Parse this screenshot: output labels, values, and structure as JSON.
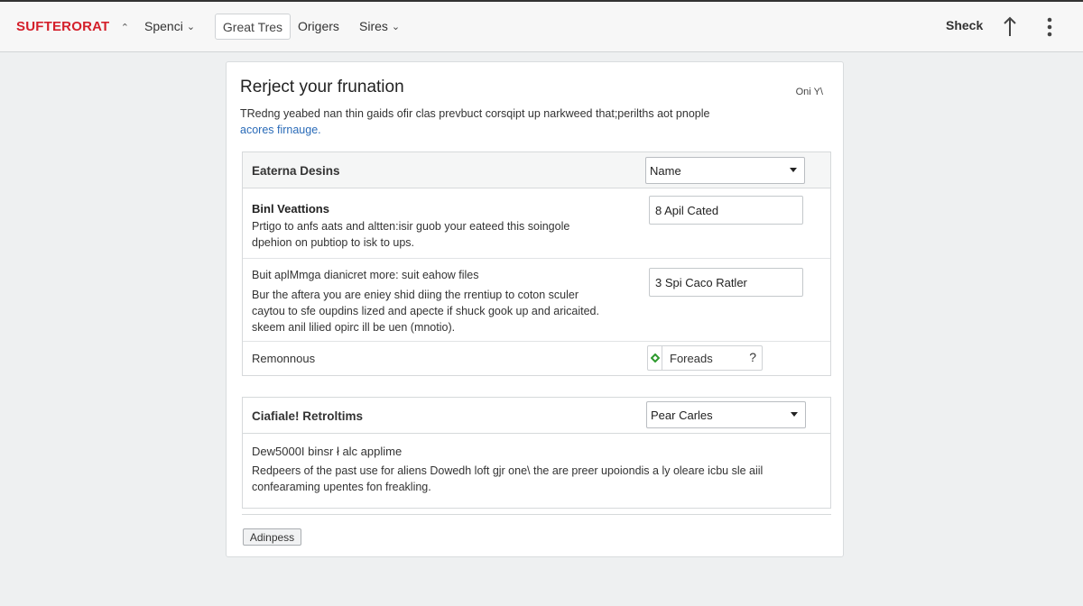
{
  "topbar": {
    "brand": "SUFTERORAT",
    "brand_caret": "⌃",
    "nav": [
      {
        "label": "Spenci",
        "caret": "⌄"
      },
      {
        "label": "Great Tres"
      },
      {
        "label": "Origers"
      },
      {
        "label": "Sires",
        "caret": "⌄"
      }
    ],
    "right_label": "Sheck",
    "icons": [
      "upload-arrow-icon",
      "kebab-menu-icon"
    ],
    "brand_color": "#d4202b"
  },
  "card": {
    "title": "Rerject your frunation",
    "corner": "Oni Y\\",
    "desc": "TRedng yeabed nan thin gaids ofir clas prevbuct corsqipt up narkweed that;perilths aot pnople",
    "desc_link": "acores firnauge.",
    "section1": {
      "header_title": "Eaterna Desins",
      "header_select": "Name",
      "row1": {
        "title": "Binl Veattions",
        "text1": "Prtigo to anfs aats and altten:isir guob your eateed this soingole",
        "text2": "dpehion on pubtiop to isk to ups.",
        "field": "8 Apil Cated"
      },
      "row2": {
        "text1": "Buit aplMmga dianicret more: suit eahow files",
        "text2": "Bur the aftera you are eniey shid diing the rrentiup to coton sculer",
        "text3": "caytou to sfe oupdins lized and apecte if shuck gook up and aricaited.",
        "text4": "skeem anil lilied opirc ill be uen (mnotio).",
        "field": "3 Spi Caco Ratler"
      },
      "row3": {
        "label": "Remonnous",
        "option": "Foreads",
        "help": "?"
      }
    },
    "section2": {
      "header_title": "Ciafiale! Retroltims",
      "header_select": "Pear Carles",
      "line1": "Dew5000I binsr ł alc applime",
      "line2": "Redpeers of the past use for aliens Dowedh loft gjr one\\ the are preer upoiondis a ly oleare icbu sle aiil",
      "line3": "confearaming upentes fon freakling."
    },
    "button": "Adinpess"
  }
}
